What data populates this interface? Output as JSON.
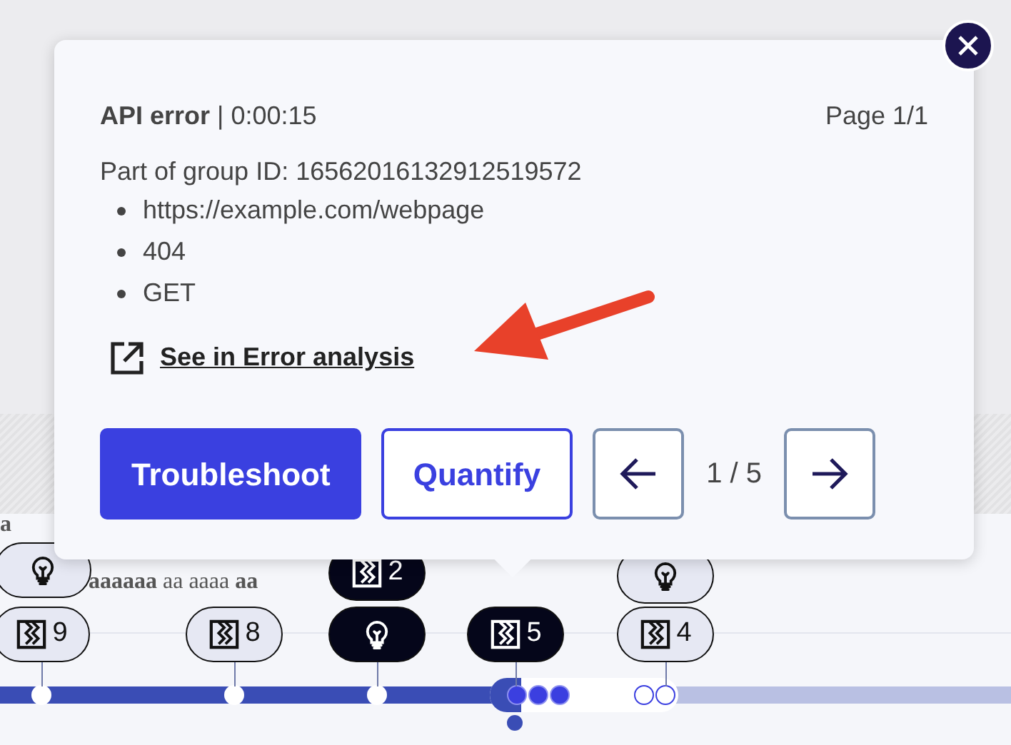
{
  "background_text": [
    {
      "text": "a"
    },
    {
      "text": "**aaaaaa** aa aaaa **aa**"
    }
  ],
  "timeline": {
    "level": 0.5,
    "markers": [
      {
        "kind": "insight",
        "selected": false
      },
      {
        "kind": "event",
        "label": "2",
        "selected": true
      },
      {
        "kind": "insight",
        "selected": false
      },
      {
        "kind": "event",
        "label": "9",
        "selected": false
      },
      {
        "kind": "event",
        "label": "8",
        "selected": false
      },
      {
        "kind": "insight",
        "selected": true
      },
      {
        "kind": "event",
        "label": "5",
        "selected": true
      },
      {
        "kind": "event",
        "label": "4",
        "selected": false
      }
    ]
  },
  "popup": {
    "title": "**API error** | 0:00:15",
    "page": "Page 1/1",
    "group": "Part of group ID: 16562016132912519572",
    "details": [
      "https://example.com/webpage",
      "404",
      "GET"
    ],
    "link": "See in Error analysis",
    "buttons": [
      {
        "kind": "primary",
        "label": "Troubleshoot"
      },
      {
        "kind": "outline",
        "label": "Quantify"
      }
    ],
    "pager": "1 / 5"
  }
}
